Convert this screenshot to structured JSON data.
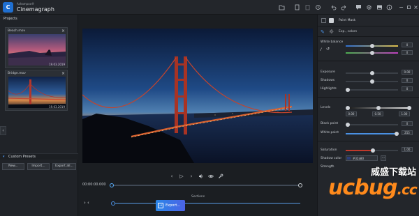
{
  "app": {
    "brand_small": "Ashampoo®",
    "brand_name": "Cinemagraph",
    "logo_glyph": "C"
  },
  "titlebar_icons": [
    "folder-icon",
    "copy-icon",
    "paste-icon",
    "history-icon",
    "undo-icon",
    "redo-icon",
    "settings-icon",
    "feedback-icon",
    "gear-icon",
    "image-icon",
    "info-icon",
    "minimize-icon",
    "restore-icon",
    "close-icon"
  ],
  "projects": {
    "header": "Projects",
    "items": [
      {
        "name": "Beach.mov",
        "date": "19.03.2019"
      },
      {
        "name": "Bridge.mov",
        "date": "19.03.2019"
      }
    ]
  },
  "presets": {
    "header": "Custom Presets",
    "buttons": {
      "new": "New...",
      "import": "Import...",
      "export_all": "Export all..."
    }
  },
  "player": {
    "timecode": "00:00:00.000",
    "sections_label": "Sections",
    "progress": 0.0,
    "export_label": "Export..."
  },
  "right_panel": {
    "paint_mask": "Paint Mask",
    "tab_label": "Exp., colors",
    "white_balance": {
      "label": "White balance",
      "value1": "0",
      "value2": "0"
    },
    "exposure": {
      "label": "Exposure",
      "value": "0.00"
    },
    "shadows": {
      "label": "Shadows",
      "value": "0"
    },
    "highlights": {
      "label": "Highlights",
      "value": "0"
    },
    "levels": {
      "label": "Levels",
      "v1": "0.00",
      "v2": "0.50",
      "v3": "1.00"
    },
    "black_point": {
      "label": "Black point",
      "value": "0"
    },
    "white_point": {
      "label": "White point",
      "value": "255"
    },
    "saturation": {
      "label": "Saturation",
      "value": "1.00"
    },
    "shadow_color": {
      "label": "Shadow color",
      "value": "#32a80"
    },
    "strength": {
      "label": "Strength"
    }
  },
  "colors": {
    "accent": "#2a86e8",
    "slider_blue": "#4a90e2",
    "slider_red": "#c0392b",
    "warm_yellow": "#d4a017"
  },
  "watermark": {
    "text_cn": "威盛下载站",
    "text_en": "ucbug",
    "suffix": ".cc"
  }
}
